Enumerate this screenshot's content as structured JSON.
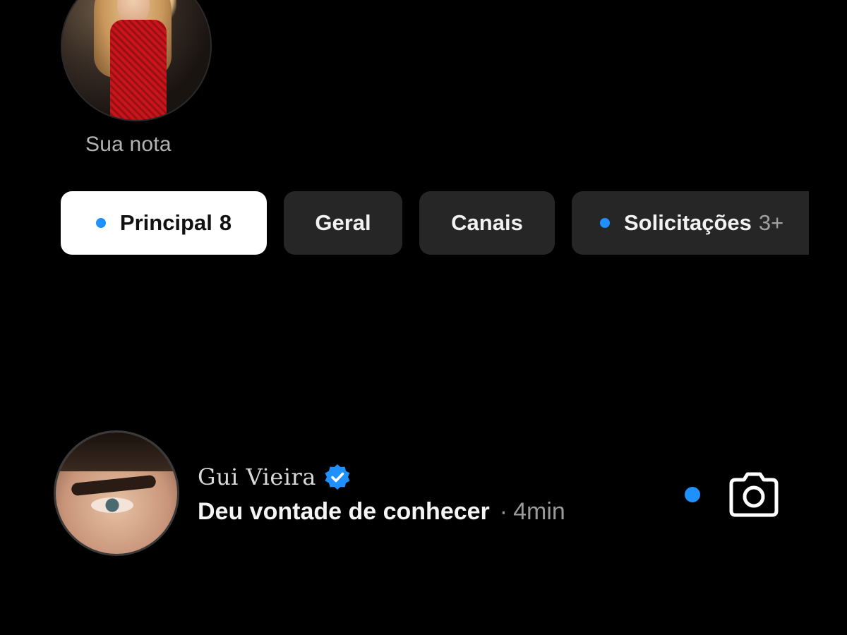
{
  "note": {
    "label": "Sua nota"
  },
  "tabs": [
    {
      "label": "Principal",
      "count": "8",
      "unread_dot": true,
      "active": true
    },
    {
      "label": "Geral",
      "count": "",
      "unread_dot": false,
      "active": false
    },
    {
      "label": "Canais",
      "count": "",
      "unread_dot": false,
      "active": false
    },
    {
      "label": "Solicitações",
      "count": "3+",
      "unread_dot": true,
      "active": false
    }
  ],
  "message": {
    "sender": "Gui Vieira",
    "verified": true,
    "preview": "Deu vontade de conhecer",
    "separator": "·",
    "time": "4min",
    "unread": true
  },
  "icons": {
    "verified": "verified-badge-icon",
    "camera": "camera-icon"
  },
  "colors": {
    "background": "#000000",
    "accent_blue": "#1e90ff",
    "tab_inactive": "#262626",
    "tab_active": "#ffffff"
  }
}
